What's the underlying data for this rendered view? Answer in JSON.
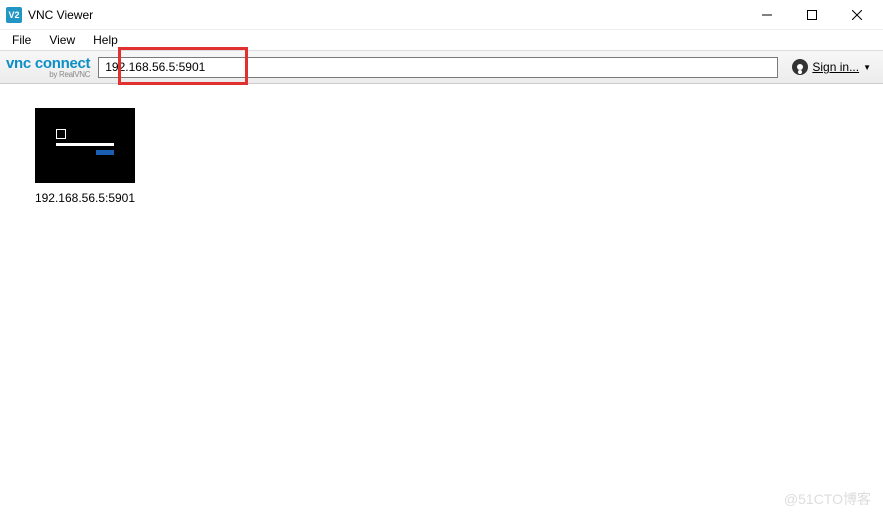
{
  "window": {
    "title": "VNC Viewer",
    "icon_label": "V2"
  },
  "menu": {
    "items": [
      "File",
      "View",
      "Help"
    ]
  },
  "toolbar": {
    "logo_main": "vnc connect",
    "logo_sub": "by RealVNC",
    "address_value": "192.168.56.5:5901",
    "signin_label": "Sign in..."
  },
  "connections": [
    {
      "label": "192.168.56.5:5901"
    }
  ],
  "watermark": "@51CTO博客"
}
